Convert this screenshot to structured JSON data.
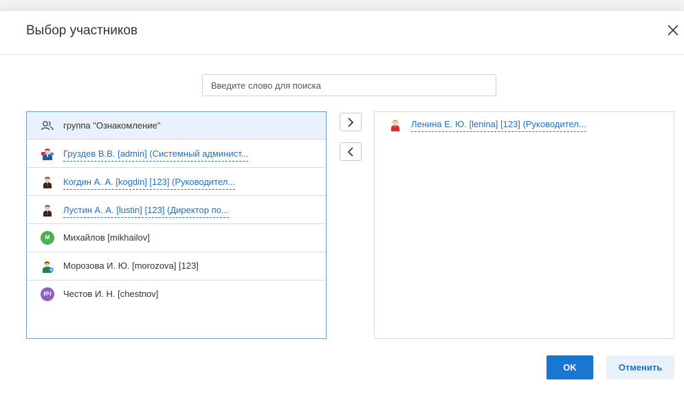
{
  "dialog": {
    "title": "Выбор участников",
    "search_placeholder": "Введите слово для поиска",
    "ok_label": "OK",
    "cancel_label": "Отменить"
  },
  "available": [
    {
      "label": "группа \"Ознакомление\"",
      "icon": "group-icon",
      "link": false,
      "selected": true
    },
    {
      "label": "Груздев В.В. [admin] (Системный админист...",
      "icon": "admin-avatar-icon",
      "link": true
    },
    {
      "label": "Когдин А. А. [kogdin] [123] (Руководител...",
      "icon": "manager-avatar-icon",
      "link": true
    },
    {
      "label": "Лустин А. А. [lustin] [123] (Директор по...",
      "icon": "manager-avatar-icon",
      "link": true
    },
    {
      "label": "Михайлов [mikhailov]",
      "icon": "initials-badge",
      "initials": "М",
      "color": "#4caf50",
      "link": false
    },
    {
      "label": "Морозова И. Ю. [morozova] [123]",
      "icon": "user-avatar-icon",
      "link": false
    },
    {
      "label": "Честов И. Н. [chestnov]",
      "icon": "initials-badge",
      "initials": "ИЧ",
      "color": "#8e5fc9",
      "link": false
    }
  ],
  "selected": [
    {
      "label": "Ленина Е. Ю. [lenina] [123] (Руководител...",
      "icon": "female-avatar-icon",
      "link": true
    }
  ],
  "colors": {
    "accent": "#1976d2",
    "link": "#1f6fc5",
    "selected_row": "#e9f1fb"
  }
}
